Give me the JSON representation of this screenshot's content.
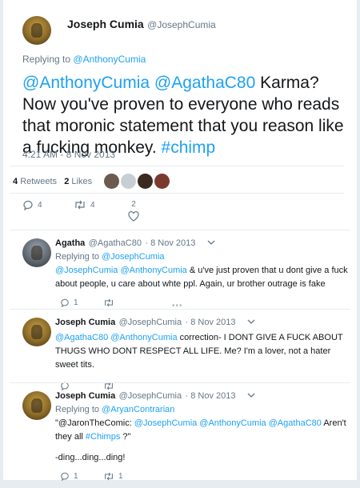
{
  "tweet": {
    "author_name": "Joseph Cumia",
    "author_handle": "@JosephCumia",
    "replying_prefix": "Replying to",
    "replying_to": "@AnthonyCumia",
    "text_mentions": "@AnthonyCumia @AgathaC80",
    "text_body": " Karma? Now you've proven to everyone who reads that moronic statement that you reason like a fucking monkey. ",
    "text_hashtag": "#chimp",
    "timestamp": "4:21 AM - 8 Nov 2013",
    "retweets_count": "4",
    "retweets_label": "Retweets",
    "likes_count": "2",
    "likes_label": "Likes",
    "reply_count": "4",
    "retweet_count": "4",
    "like_count": "2"
  },
  "replies": [
    {
      "author_name": "Agatha",
      "author_handle": "@AgathaC80",
      "date": "· 8 Nov 2013",
      "replying_prefix": "Replying to",
      "replying_to": "@JosephCumia",
      "mentions": "@JosephCumia @AnthonyCumia",
      "body": " & u've just proven that u dont give a fuck about people, u care about whte ppl. Again, ur brother outrage is fake",
      "reply_count": "1"
    },
    {
      "author_name": "Joseph Cumia",
      "author_handle": "@JosephCumia",
      "date": "· 8 Nov 2013",
      "mentions": "@AgathaC80 @AnthonyCumia",
      "body": " correction- I DONT GIVE A FUCK  ABOUT THUGS WHO DONT RESPECT ALL LIFE. Me? I'm a lover, not a hater sweet tits."
    },
    {
      "author_name": "Joseph Cumia",
      "author_handle": "@JosephCumia",
      "date": "· 8 Nov 2013",
      "replying_prefix": "Replying to",
      "replying_to": "@AryanContrarian",
      "quote_open": "\"@JaronTheComic: ",
      "mentions": "@JosephCumia @AnthonyCumia @AgathaC80",
      "body_a": " Aren't they all ",
      "hashtag": "#Chimps",
      "body_b": " ?\"",
      "line2": "-ding...ding...ding!",
      "reply_count": "1",
      "retweet_count": "1"
    }
  ],
  "colors": {
    "link": "#1da1f2",
    "muted": "#657786",
    "divider": "#e6ecf0"
  }
}
